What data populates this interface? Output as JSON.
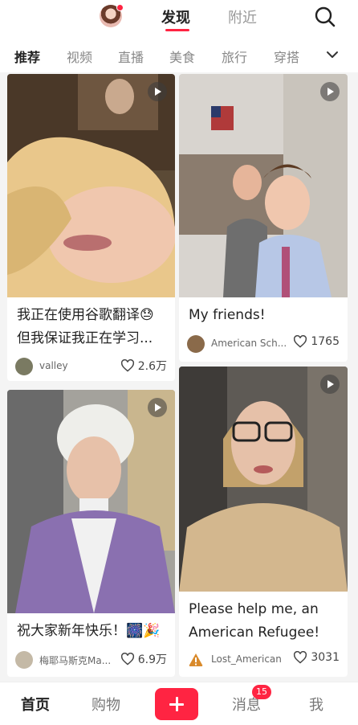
{
  "header": {
    "tab_discover": "发现",
    "tab_nearby": "附近"
  },
  "categories": [
    "推荐",
    "视频",
    "直播",
    "美食",
    "旅行",
    "穿搭"
  ],
  "feed": [
    {
      "title_line1": "我正在使用谷歌翻译😓",
      "title_line2": "但我保证我正在学习...",
      "user": "valley",
      "likes": "2.6万"
    },
    {
      "title_line1": "My friends!",
      "user": "American Sch...",
      "likes": "1765"
    },
    {
      "title_line1": "祝大家新年快乐！🎆🎉",
      "user": "梅耶马斯克Ma...",
      "likes": "6.9万"
    },
    {
      "title_line1": "Please help me, an",
      "title_line2": "American Refugee!",
      "user": "Lost_American",
      "likes": "3031"
    }
  ],
  "bottom_nav": {
    "home": "首页",
    "shop": "购物",
    "messages": "消息",
    "messages_badge": "15",
    "me": "我"
  },
  "colors": {
    "accent": "#ff2442"
  }
}
